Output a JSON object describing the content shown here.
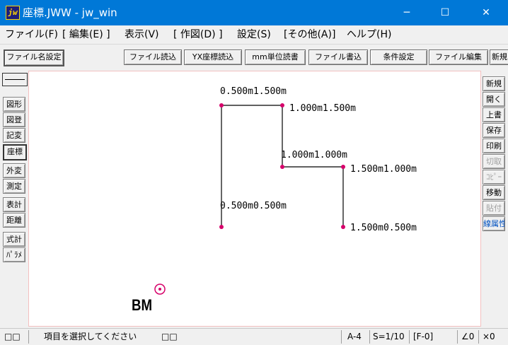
{
  "window": {
    "icon_text": "jw",
    "title": "座標.JWW - jw_win",
    "minimize": "─",
    "maximize": "☐",
    "close": "✕"
  },
  "menu": [
    "ファイル(F)",
    "[ 編集(E) ]",
    "表示(V)",
    "[ 作図(D) ]",
    "設定(S)",
    "[その他(A)]",
    "ヘルプ(H)"
  ],
  "toolbar": {
    "file_name_settings": "ファイル名設定",
    "buttons": [
      "ファイル読込",
      "YX座標読込",
      "mm単位読書",
      "ファイル書込",
      "条件設定",
      "ファイル編集",
      "新規"
    ]
  },
  "left_tools": [
    "図形",
    "図登",
    "記変",
    "座標",
    "外変",
    "測定",
    "表計",
    "距離",
    "式計",
    "ﾊﾟﾗﾒ"
  ],
  "left_active": "座標",
  "right_tools": [
    "新規",
    "開く",
    "上書",
    "保存",
    "印刷",
    "切取",
    "ｺﾋﾟｰ",
    "移動",
    "貼付",
    "線属性"
  ],
  "canvas": {
    "labels": {
      "p1": "0.500m1.500m",
      "p2": "1.000m1.500m",
      "p3": "1.000m1.000m",
      "p4": "1.500m1.000m",
      "p5": "0.500m0.500m",
      "p6": "1.500m0.500m"
    },
    "bm_label": "BM",
    "point_color": "#d6006a",
    "bm_color": "#d6006a"
  },
  "status": {
    "left_boxes": "□□",
    "message": "項目を選択してください",
    "mid_boxes": "□□",
    "paper": "A-4",
    "scale": "S=1/10",
    "layer": "[F-0]",
    "angle": "∠0",
    "zoom": "×0"
  }
}
